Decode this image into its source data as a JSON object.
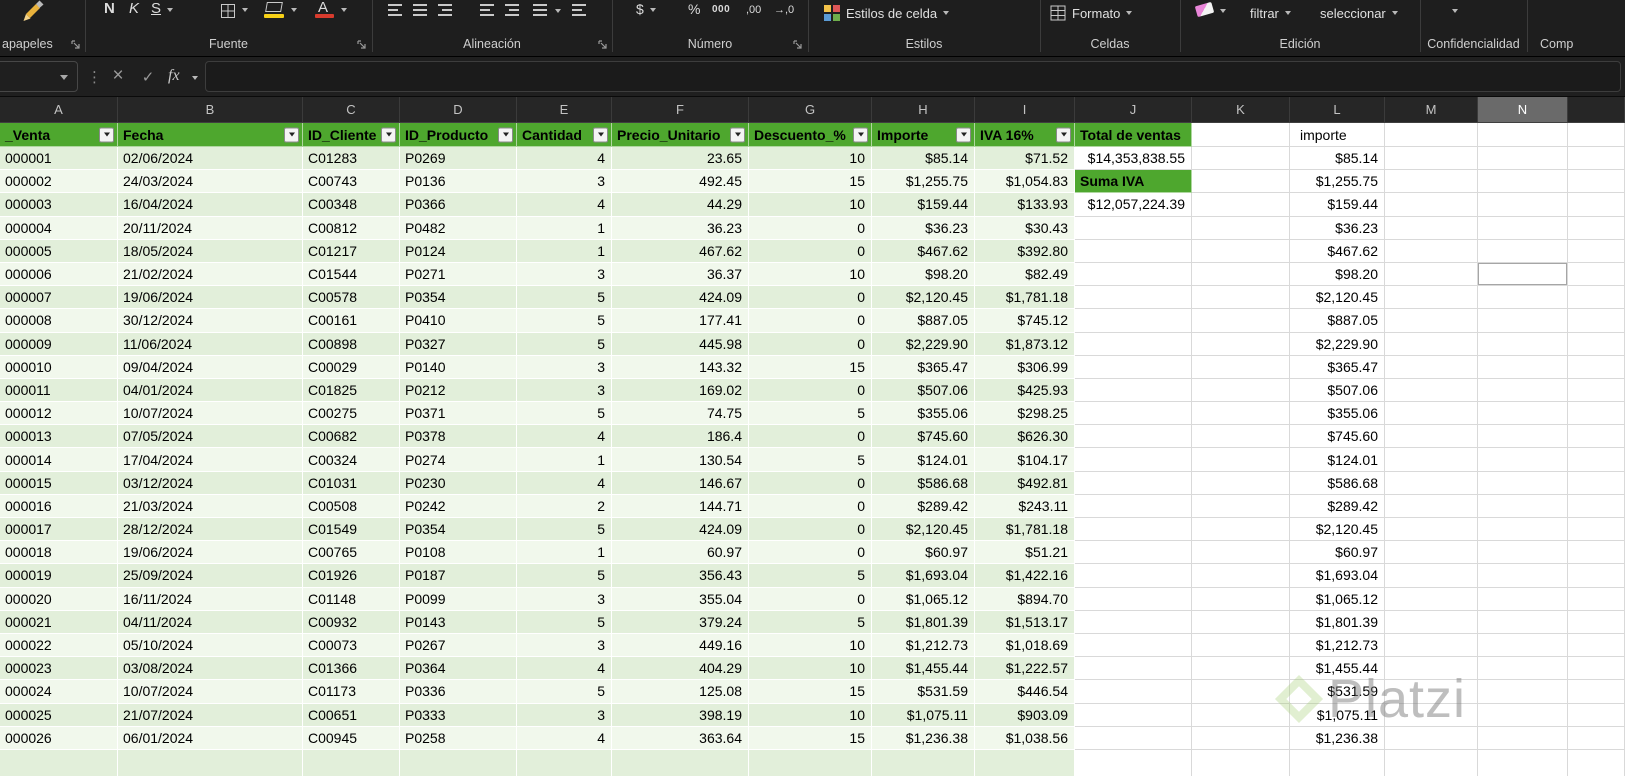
{
  "ribbon": {
    "groups": {
      "clipboard": {
        "label": "apapeles"
      },
      "font": {
        "label": "Fuente"
      },
      "alignment": {
        "label": "Alineación"
      },
      "number": {
        "label": "Número"
      },
      "styles": {
        "label": "Estilos"
      },
      "cells": {
        "label": "Celdas"
      },
      "editing": {
        "label": "Edición"
      },
      "sensitivity": {
        "label": "Confidencialidad"
      },
      "share": {
        "label": "Comp"
      }
    },
    "font_buttons": {
      "bold": "N",
      "italic": "K",
      "underline": "S"
    },
    "icons": {
      "font_color_glyph": "A"
    },
    "number_buttons": {
      "currency": "$",
      "percent": "%",
      "thousands": "000",
      "inc_decimal": ",00",
      "dec_decimal": "→,0"
    },
    "style_buttons": {
      "cell_styles": "Estilos de celda"
    },
    "cells_buttons": {
      "format": "Formato"
    },
    "editing_buttons": {
      "filter": "filtrar",
      "select": "seleccionar"
    }
  },
  "formula_bar": {
    "menu_dots": "⋮",
    "cancel": "×",
    "enter": "✓",
    "fx": "fx",
    "name_box": "",
    "formula": ""
  },
  "sheet": {
    "column_letters": [
      "A",
      "B",
      "C",
      "D",
      "E",
      "F",
      "G",
      "H",
      "I",
      "J",
      "K",
      "L",
      "M",
      "N"
    ],
    "selected_column": "N",
    "selected_cell": {
      "column": "N",
      "row_index": 6
    },
    "header_row": {
      "cells": [
        "_Venta",
        "Fecha",
        "ID_Cliente",
        "ID_Producto",
        "Cantidad",
        "Precio_Unitario",
        "Descuento_%",
        "Importe",
        "IVA 16%"
      ],
      "total_header": "Total de ventas",
      "importe_header": "importe"
    },
    "rows": [
      {
        "cells": [
          "000001",
          "02/06/2024",
          "C01283",
          "P0269",
          "4",
          "23.65",
          "10",
          "$85.14",
          "$71.52"
        ],
        "j": "$14,353,838.55",
        "j_label": false,
        "l": "$85.14"
      },
      {
        "cells": [
          "000002",
          "24/03/2024",
          "C00743",
          "P0136",
          "3",
          "492.45",
          "15",
          "$1,255.75",
          "$1,054.83"
        ],
        "j": "Suma IVA",
        "j_label": true,
        "l": "$1,255.75"
      },
      {
        "cells": [
          "000003",
          "16/04/2024",
          "C00348",
          "P0366",
          "4",
          "44.29",
          "10",
          "$159.44",
          "$133.93"
        ],
        "j": "$12,057,224.39",
        "j_label": false,
        "l": "$159.44"
      },
      {
        "cells": [
          "000004",
          "20/11/2024",
          "C00812",
          "P0482",
          "1",
          "36.23",
          "0",
          "$36.23",
          "$30.43"
        ],
        "l": "$36.23"
      },
      {
        "cells": [
          "000005",
          "18/05/2024",
          "C01217",
          "P0124",
          "1",
          "467.62",
          "0",
          "$467.62",
          "$392.80"
        ],
        "l": "$467.62"
      },
      {
        "cells": [
          "000006",
          "21/02/2024",
          "C01544",
          "P0271",
          "3",
          "36.37",
          "10",
          "$98.20",
          "$82.49"
        ],
        "l": "$98.20"
      },
      {
        "cells": [
          "000007",
          "19/06/2024",
          "C00578",
          "P0354",
          "5",
          "424.09",
          "0",
          "$2,120.45",
          "$1,781.18"
        ],
        "l": "$2,120.45"
      },
      {
        "cells": [
          "000008",
          "30/12/2024",
          "C00161",
          "P0410",
          "5",
          "177.41",
          "0",
          "$887.05",
          "$745.12"
        ],
        "l": "$887.05"
      },
      {
        "cells": [
          "000009",
          "11/06/2024",
          "C00898",
          "P0327",
          "5",
          "445.98",
          "0",
          "$2,229.90",
          "$1,873.12"
        ],
        "l": "$2,229.90"
      },
      {
        "cells": [
          "000010",
          "09/04/2024",
          "C00029",
          "P0140",
          "3",
          "143.32",
          "15",
          "$365.47",
          "$306.99"
        ],
        "l": "$365.47"
      },
      {
        "cells": [
          "000011",
          "04/01/2024",
          "C01825",
          "P0212",
          "3",
          "169.02",
          "0",
          "$507.06",
          "$425.93"
        ],
        "l": "$507.06"
      },
      {
        "cells": [
          "000012",
          "10/07/2024",
          "C00275",
          "P0371",
          "5",
          "74.75",
          "5",
          "$355.06",
          "$298.25"
        ],
        "l": "$355.06"
      },
      {
        "cells": [
          "000013",
          "07/05/2024",
          "C00682",
          "P0378",
          "4",
          "186.4",
          "0",
          "$745.60",
          "$626.30"
        ],
        "l": "$745.60"
      },
      {
        "cells": [
          "000014",
          "17/04/2024",
          "C00324",
          "P0274",
          "1",
          "130.54",
          "5",
          "$124.01",
          "$104.17"
        ],
        "l": "$124.01"
      },
      {
        "cells": [
          "000015",
          "03/12/2024",
          "C01031",
          "P0230",
          "4",
          "146.67",
          "0",
          "$586.68",
          "$492.81"
        ],
        "l": "$586.68"
      },
      {
        "cells": [
          "000016",
          "21/03/2024",
          "C00508",
          "P0242",
          "2",
          "144.71",
          "0",
          "$289.42",
          "$243.11"
        ],
        "l": "$289.42"
      },
      {
        "cells": [
          "000017",
          "28/12/2024",
          "C01549",
          "P0354",
          "5",
          "424.09",
          "0",
          "$2,120.45",
          "$1,781.18"
        ],
        "l": "$2,120.45"
      },
      {
        "cells": [
          "000018",
          "19/06/2024",
          "C00765",
          "P0108",
          "1",
          "60.97",
          "0",
          "$60.97",
          "$51.21"
        ],
        "l": "$60.97"
      },
      {
        "cells": [
          "000019",
          "25/09/2024",
          "C01926",
          "P0187",
          "5",
          "356.43",
          "5",
          "$1,693.04",
          "$1,422.16"
        ],
        "l": "$1,693.04"
      },
      {
        "cells": [
          "000020",
          "16/11/2024",
          "C01148",
          "P0099",
          "3",
          "355.04",
          "0",
          "$1,065.12",
          "$894.70"
        ],
        "l": "$1,065.12"
      },
      {
        "cells": [
          "000021",
          "04/11/2024",
          "C00932",
          "P0143",
          "5",
          "379.24",
          "5",
          "$1,801.39",
          "$1,513.17"
        ],
        "l": "$1,801.39"
      },
      {
        "cells": [
          "000022",
          "05/10/2024",
          "C00073",
          "P0267",
          "3",
          "449.16",
          "10",
          "$1,212.73",
          "$1,018.69"
        ],
        "l": "$1,212.73"
      },
      {
        "cells": [
          "000023",
          "03/08/2024",
          "C01366",
          "P0364",
          "4",
          "404.29",
          "10",
          "$1,455.44",
          "$1,222.57"
        ],
        "l": "$1,455.44"
      },
      {
        "cells": [
          "000024",
          "10/07/2024",
          "C01173",
          "P0336",
          "5",
          "125.08",
          "15",
          "$531.59",
          "$446.54"
        ],
        "l": "$531.59"
      },
      {
        "cells": [
          "000025",
          "21/07/2024",
          "C00651",
          "P0333",
          "3",
          "398.19",
          "10",
          "$1,075.11",
          "$903.09"
        ],
        "l": "$1,075.11"
      },
      {
        "cells": [
          "000026",
          "06/01/2024",
          "C00945",
          "P0258",
          "4",
          "363.64",
          "15",
          "$1,236.38",
          "$1,038.56"
        ],
        "l": "$1,236.38"
      }
    ]
  },
  "watermark": {
    "text": "Platzi"
  }
}
